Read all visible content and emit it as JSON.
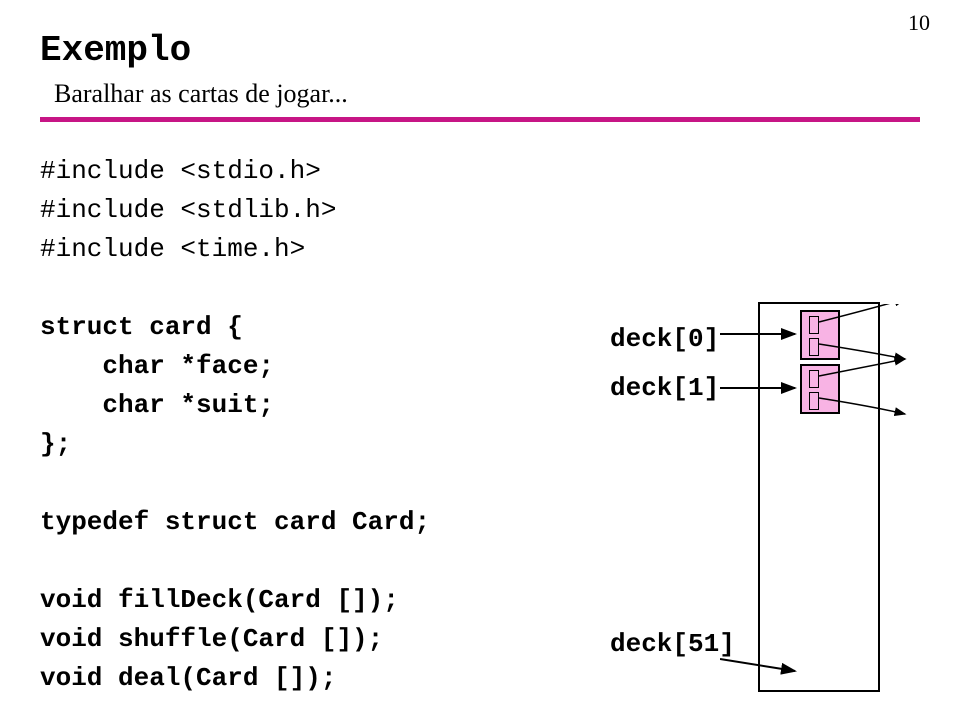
{
  "pageNumber": "10",
  "title": "Exemplo",
  "subtitle": "Baralhar as cartas de jogar...",
  "code": {
    "line1": "#include <stdio.h>",
    "line2": "#include <stdlib.h>",
    "line3": "#include <time.h>",
    "line4": "struct card {",
    "line5": "    char *face;",
    "line6": "    char *suit;",
    "line7": "};",
    "line8": "typedef struct card Card;",
    "line9": "void fillDeck(Card []);",
    "line10": "void shuffle(Card []);",
    "line11": "void deal(Card []);"
  },
  "labels": {
    "deck0": "deck[0]",
    "deck1": "deck[1]",
    "deck51": "deck[51]"
  }
}
